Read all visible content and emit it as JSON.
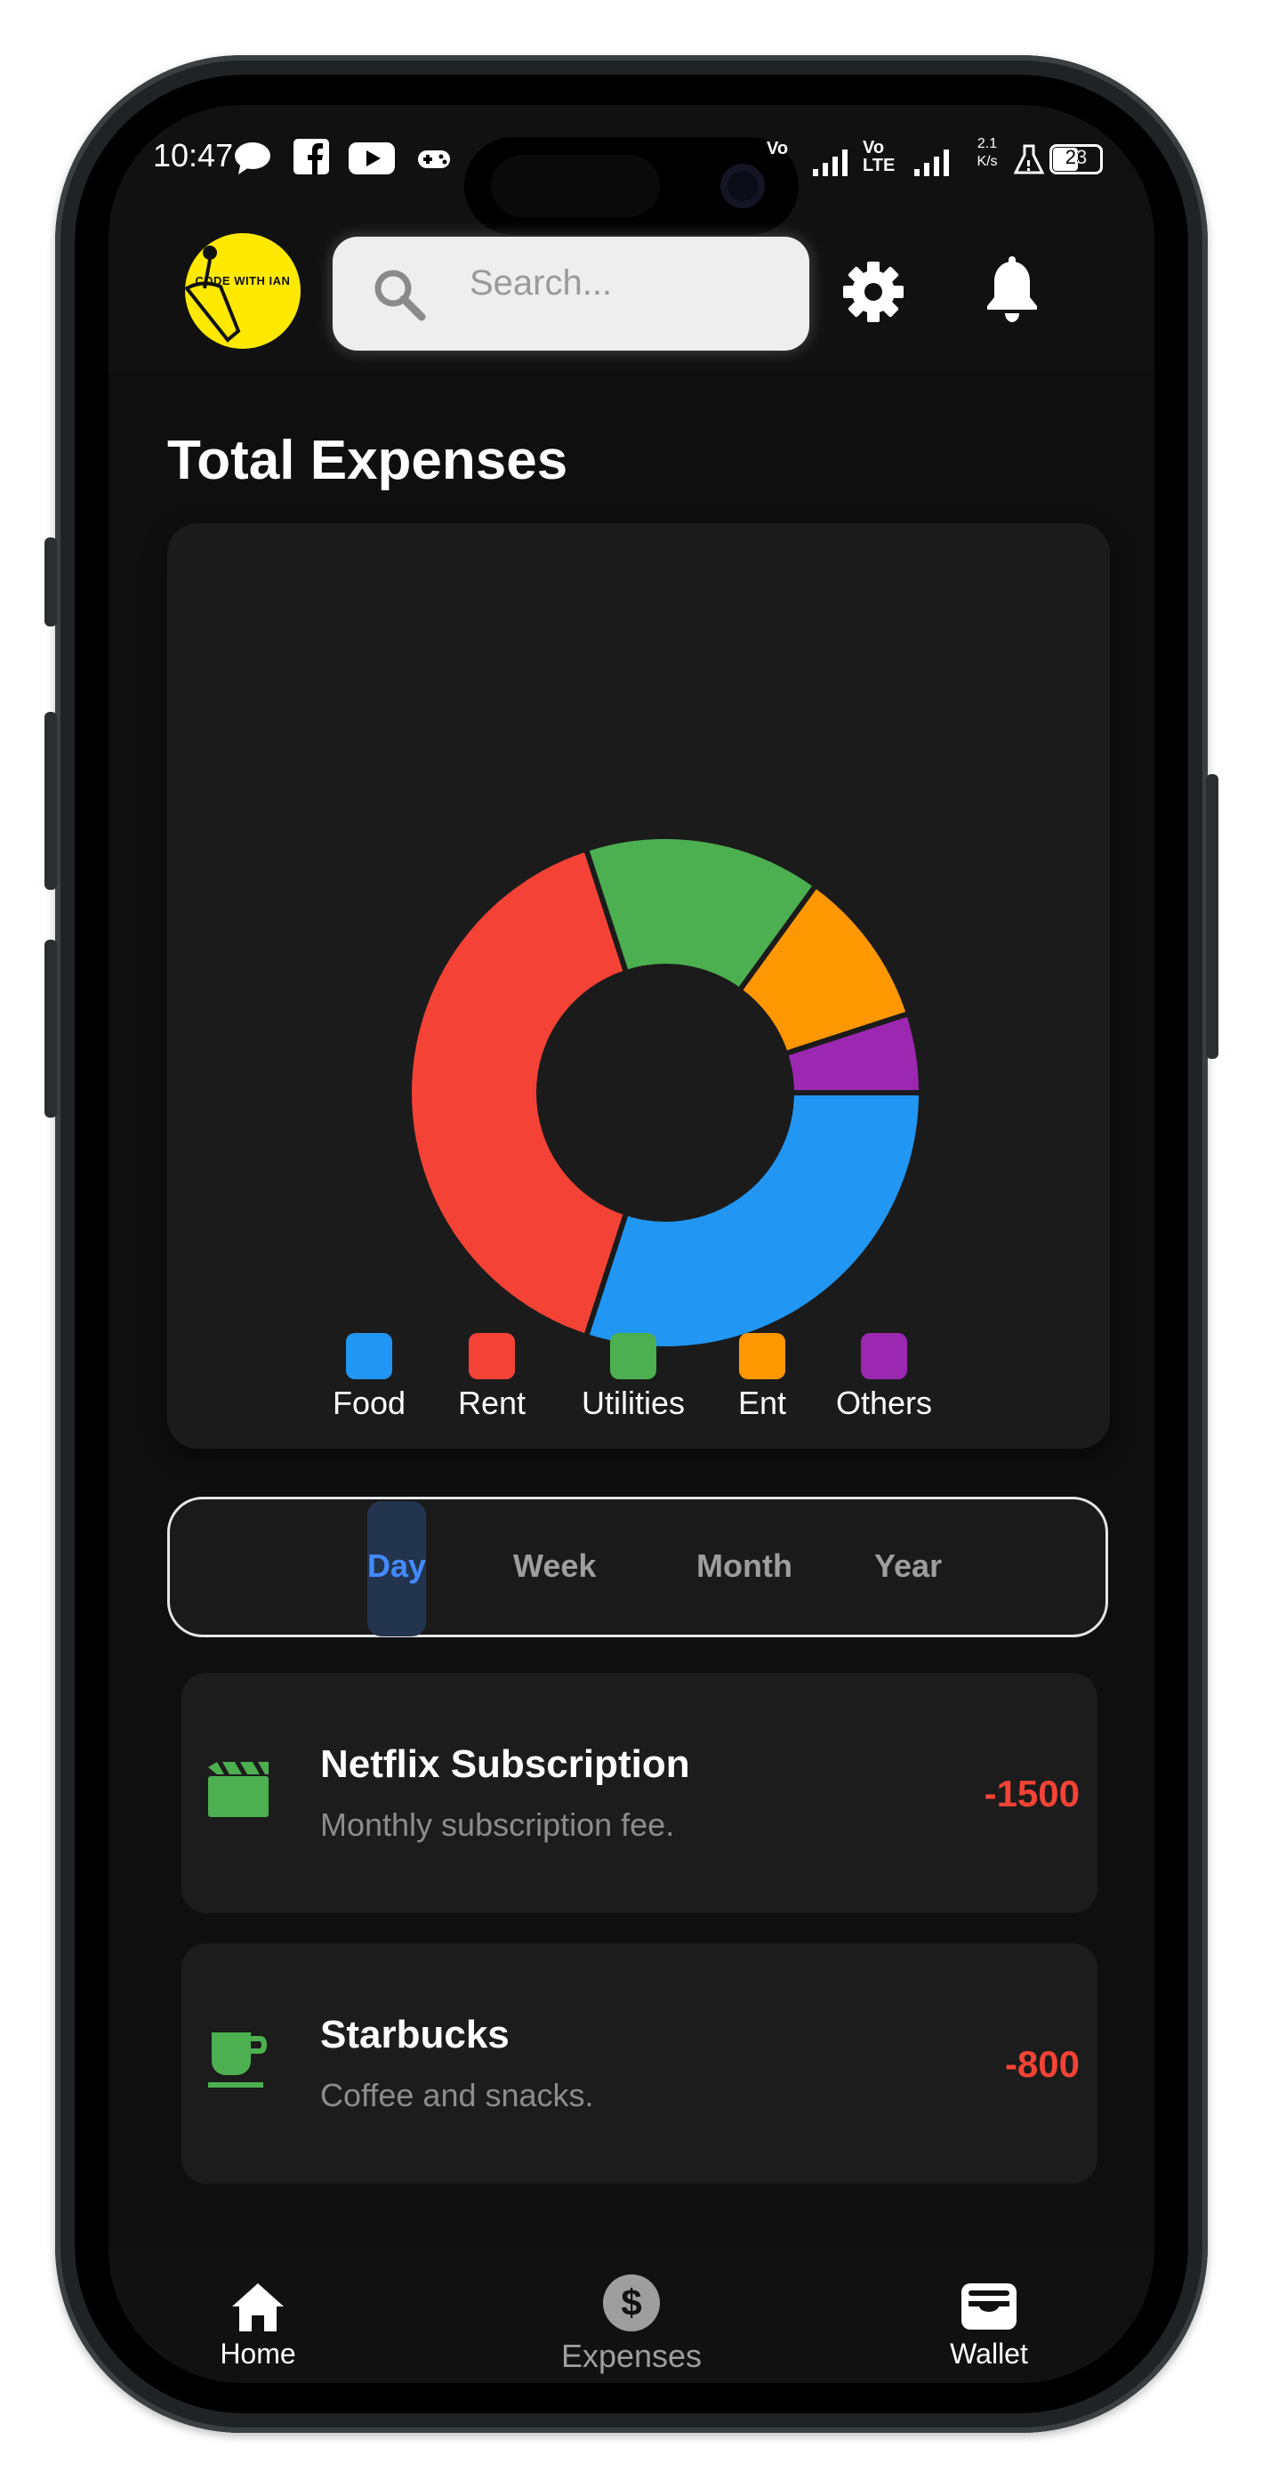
{
  "status_bar": {
    "time": "10:47",
    "carrier_1": "Vo",
    "carrier_2": "Vo LTE",
    "net_speed": "2.1 K/s",
    "battery": "23"
  },
  "header": {
    "logo_text": "CODE WITH IAN",
    "search_placeholder": "Search..."
  },
  "main": {
    "title": "Total Expenses"
  },
  "chart_data": {
    "type": "pie",
    "categories": [
      "Food",
      "Rent",
      "Utilities",
      "Ent",
      "Others"
    ],
    "values": [
      30,
      40,
      15,
      10,
      5
    ],
    "colors": [
      "#2196f3",
      "#f44336",
      "#4caf50",
      "#ff9800",
      "#9c27b0"
    ],
    "legend_position": "bottom"
  },
  "period_tabs": [
    {
      "label": "Day",
      "active": true
    },
    {
      "label": "Week",
      "active": false
    },
    {
      "label": "Month",
      "active": false
    },
    {
      "label": "Year",
      "active": false
    }
  ],
  "expenses": [
    {
      "icon": "movie-clapper-icon",
      "title": "Netflix Subscription",
      "description": "Monthly subscription fee.",
      "amount": "-1500"
    },
    {
      "icon": "coffee-cup-icon",
      "title": "Starbucks",
      "description": "Coffee and snacks.",
      "amount": "-800"
    }
  ],
  "bottom_nav": [
    {
      "icon": "home-icon",
      "label": "Home"
    },
    {
      "icon": "dollar-icon",
      "label": "Expenses"
    },
    {
      "icon": "wallet-icon",
      "label": "Wallet"
    }
  ],
  "colors": {
    "accent": "#448aff",
    "expense_amount": "#f44336",
    "icon_green": "#4caf50"
  }
}
